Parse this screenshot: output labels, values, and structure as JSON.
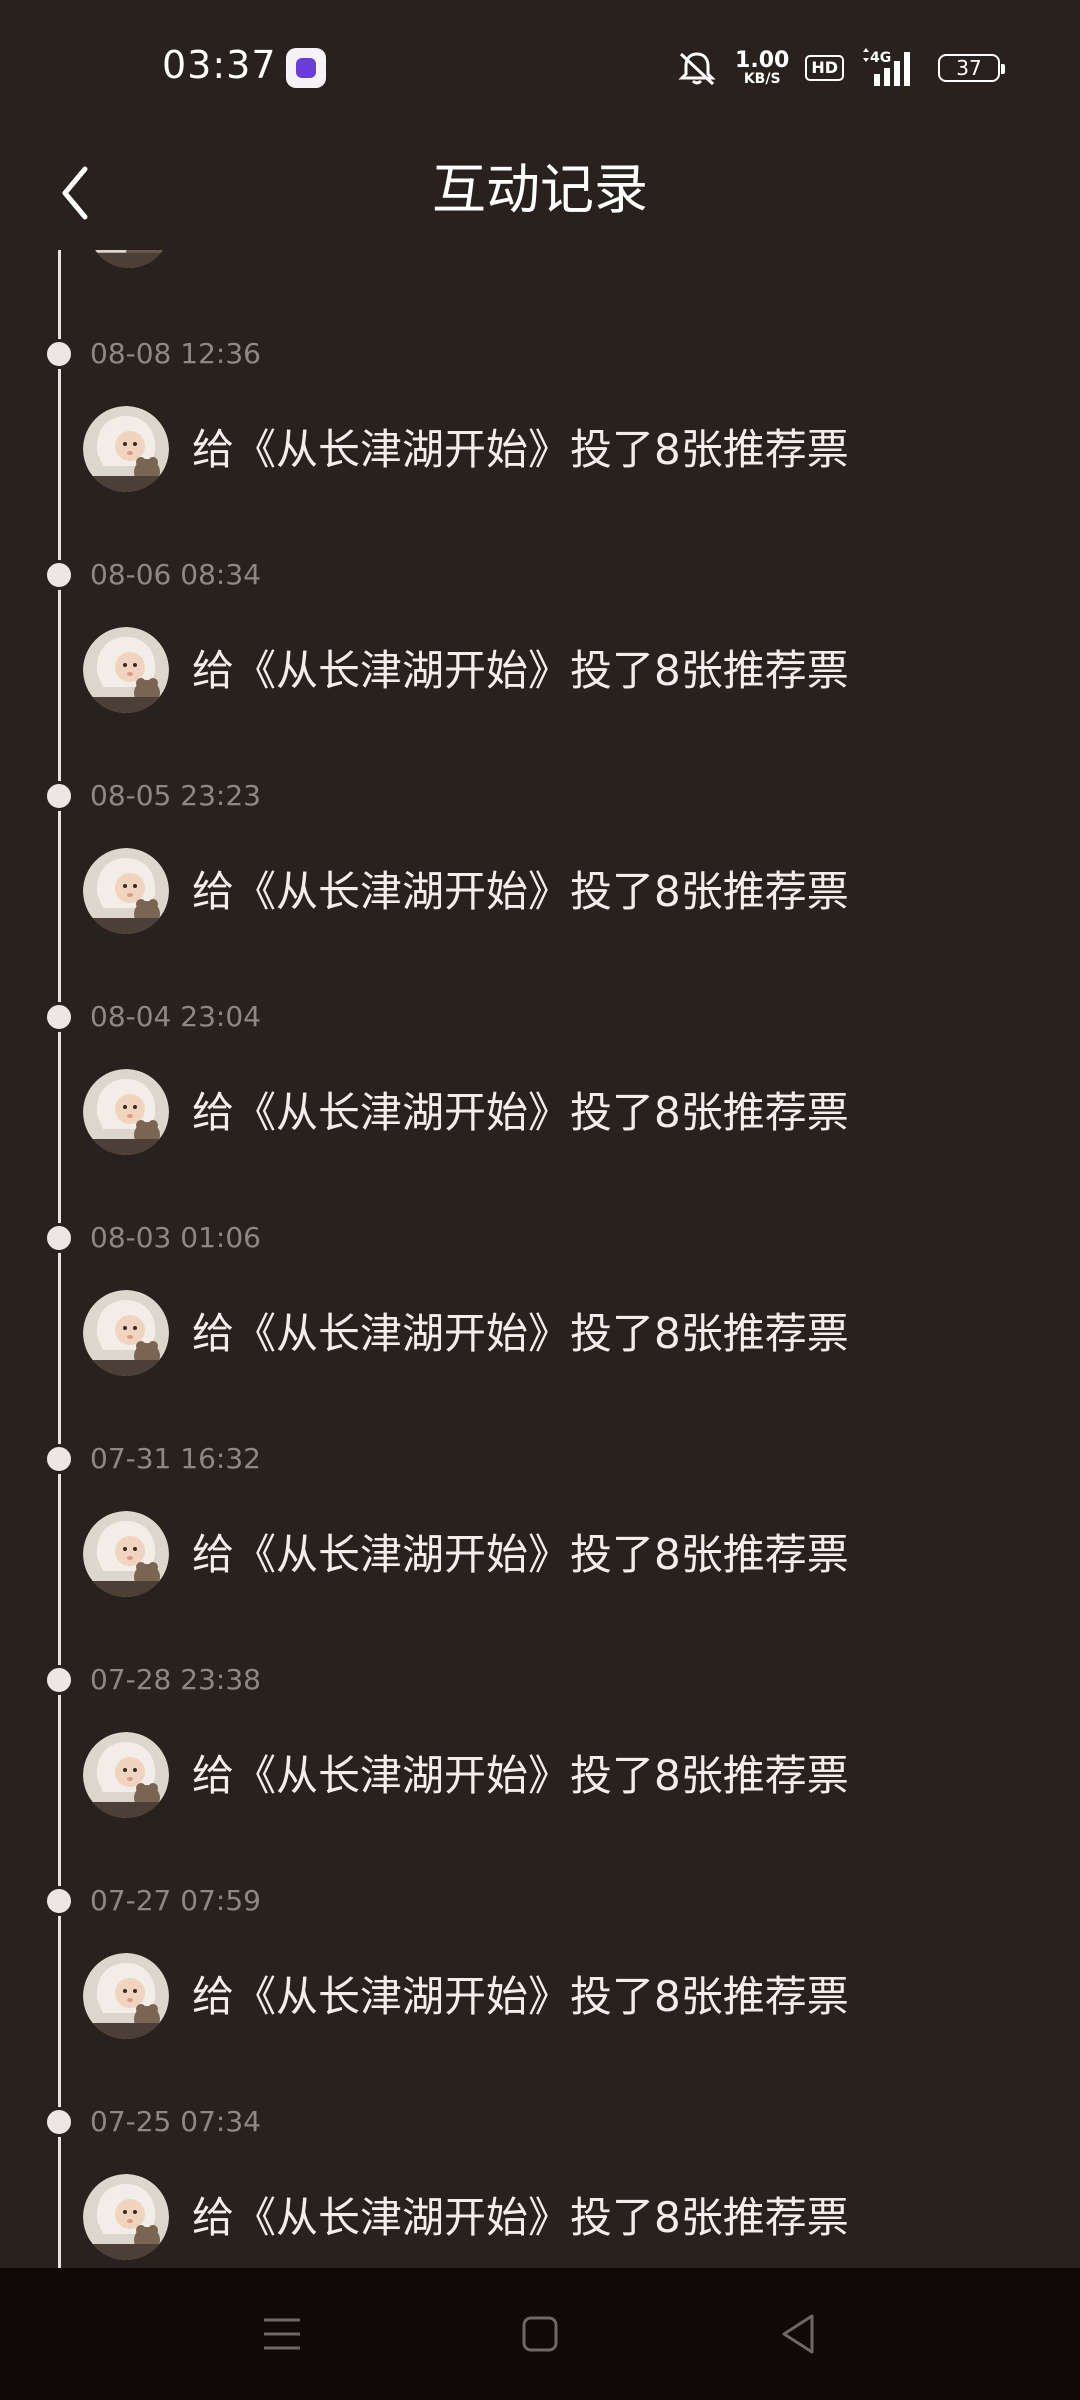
{
  "status_bar": {
    "time": "03:37",
    "net_speed_value": "1.00",
    "net_speed_unit": "KB/S",
    "hd_label": "HD",
    "network_label": "4G",
    "battery_level": "37"
  },
  "header": {
    "title": "互动记录",
    "back_icon": "chevron-left-icon"
  },
  "avatar_icon": "baby-avatar",
  "entries": [
    {
      "time": "08-08 12:36",
      "text": "给《从长津湖开始》投了8张推荐票"
    },
    {
      "time": "08-06 08:34",
      "text": "给《从长津湖开始》投了8张推荐票"
    },
    {
      "time": "08-05 23:23",
      "text": "给《从长津湖开始》投了8张推荐票"
    },
    {
      "time": "08-04 23:04",
      "text": "给《从长津湖开始》投了8张推荐票"
    },
    {
      "time": "08-03 01:06",
      "text": "给《从长津湖开始》投了8张推荐票"
    },
    {
      "time": "07-31 16:32",
      "text": "给《从长津湖开始》投了8张推荐票"
    },
    {
      "time": "07-28 23:38",
      "text": "给《从长津湖开始》投了8张推荐票"
    },
    {
      "time": "07-27 07:59",
      "text": "给《从长津湖开始》投了8张推荐票"
    },
    {
      "time": "07-25 07:34",
      "text": "给《从长津湖开始》投了8张推荐票"
    }
  ],
  "nav_bar": {
    "menu_icon": "menu-icon",
    "home_icon": "home-square-icon",
    "back_icon": "back-triangle-icon"
  },
  "colors": {
    "background": "#29211e",
    "nav_background": "#110907",
    "timeline": "#e8e3e1",
    "time_text": "#8e8784",
    "entry_text": "#f3eeec"
  }
}
